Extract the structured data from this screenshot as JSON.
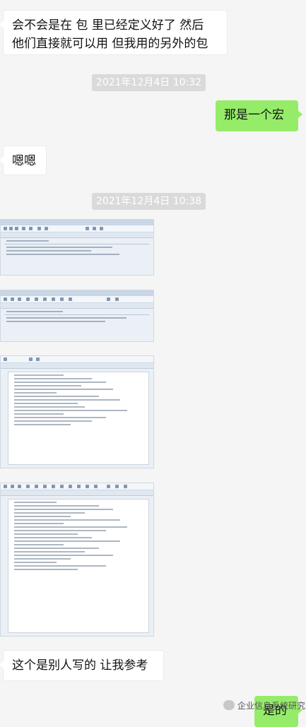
{
  "messages": {
    "m1": "会不会是在 包 里已经定义好了 然后\n他们直接就可以用 但我用的另外的包",
    "m2": "那是一个宏",
    "m3": "嗯嗯",
    "m4": "这个是别人写的 让我参考",
    "m5": "是的"
  },
  "timestamps": {
    "t1": "2021年12月4日 10:32",
    "t2": "2021年12月4日 10:38"
  },
  "watermark": {
    "text": "企业信息系统研究"
  },
  "colors": {
    "background": "#f5f5f5",
    "bubble_self": "#95ec69",
    "bubble_other": "#ffffff",
    "timestamp_bg": "#dadada"
  }
}
